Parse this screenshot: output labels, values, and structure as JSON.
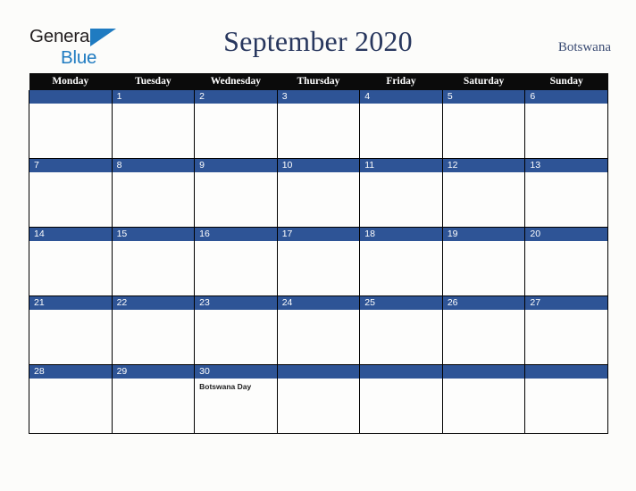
{
  "logo": {
    "word1": "General",
    "word2": "Blue",
    "triangle_color": "#1f7bc1"
  },
  "header": {
    "title": "September 2020",
    "country": "Botswana"
  },
  "colors": {
    "header_row_bg": "#0b0b0b",
    "date_band_bg": "#2e5496",
    "title_color": "#28375e",
    "page_bg": "#fcfcfa"
  },
  "calendar": {
    "weekday_headers": [
      "Monday",
      "Tuesday",
      "Wednesday",
      "Thursday",
      "Friday",
      "Saturday",
      "Sunday"
    ],
    "weeks": [
      [
        {
          "day": "",
          "event": ""
        },
        {
          "day": "1",
          "event": ""
        },
        {
          "day": "2",
          "event": ""
        },
        {
          "day": "3",
          "event": ""
        },
        {
          "day": "4",
          "event": ""
        },
        {
          "day": "5",
          "event": ""
        },
        {
          "day": "6",
          "event": ""
        }
      ],
      [
        {
          "day": "7",
          "event": ""
        },
        {
          "day": "8",
          "event": ""
        },
        {
          "day": "9",
          "event": ""
        },
        {
          "day": "10",
          "event": ""
        },
        {
          "day": "11",
          "event": ""
        },
        {
          "day": "12",
          "event": ""
        },
        {
          "day": "13",
          "event": ""
        }
      ],
      [
        {
          "day": "14",
          "event": ""
        },
        {
          "day": "15",
          "event": ""
        },
        {
          "day": "16",
          "event": ""
        },
        {
          "day": "17",
          "event": ""
        },
        {
          "day": "18",
          "event": ""
        },
        {
          "day": "19",
          "event": ""
        },
        {
          "day": "20",
          "event": ""
        }
      ],
      [
        {
          "day": "21",
          "event": ""
        },
        {
          "day": "22",
          "event": ""
        },
        {
          "day": "23",
          "event": ""
        },
        {
          "day": "24",
          "event": ""
        },
        {
          "day": "25",
          "event": ""
        },
        {
          "day": "26",
          "event": ""
        },
        {
          "day": "27",
          "event": ""
        }
      ],
      [
        {
          "day": "28",
          "event": ""
        },
        {
          "day": "29",
          "event": ""
        },
        {
          "day": "30",
          "event": "Botswana Day"
        },
        {
          "day": "",
          "event": ""
        },
        {
          "day": "",
          "event": ""
        },
        {
          "day": "",
          "event": ""
        },
        {
          "day": "",
          "event": ""
        }
      ]
    ]
  }
}
